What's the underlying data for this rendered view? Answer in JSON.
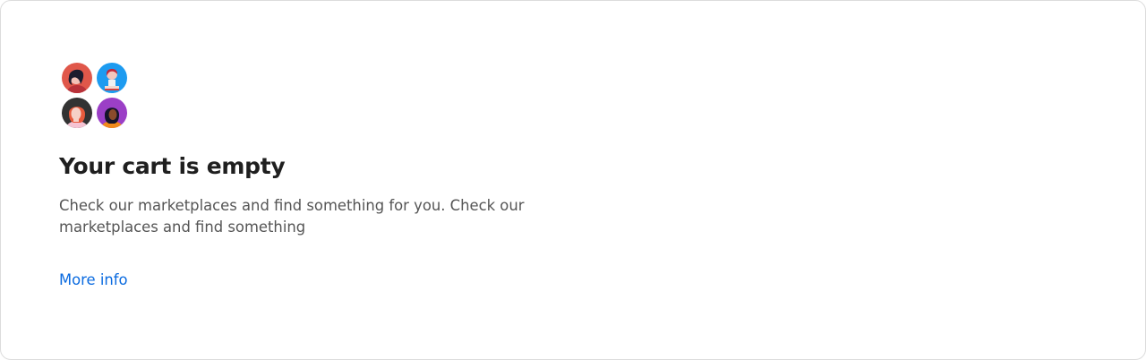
{
  "empty_state": {
    "title": "Your cart is empty",
    "description": "Check our marketplaces and find something for you. Check our marketplaces and find something",
    "link_label": "More info"
  },
  "avatars": [
    {
      "icon": "person-avatar-icon",
      "bg_color": "#e0574a"
    },
    {
      "icon": "person-avatar-icon",
      "bg_color": "#1d9bf0"
    },
    {
      "icon": "person-avatar-icon",
      "bg_color": "#333333"
    },
    {
      "icon": "person-avatar-icon",
      "bg_color": "#9b3fc6"
    }
  ],
  "colors": {
    "link": "#0b6be0",
    "title": "#1f1f1f",
    "text": "#555555",
    "border": "#dcdcdc"
  }
}
